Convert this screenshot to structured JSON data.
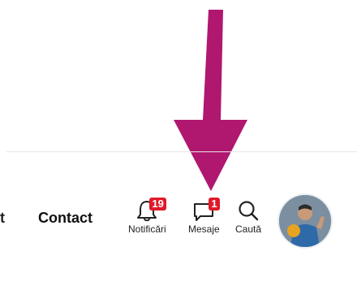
{
  "header": {
    "nav_partial": "t",
    "nav_contact": "Contact",
    "notifications": {
      "label": "Notificări",
      "badge": "19"
    },
    "messages": {
      "label": "Mesaje",
      "badge": "1"
    },
    "search": {
      "label": "Caută"
    }
  },
  "colors": {
    "arrow": "#b0176e",
    "badge": "#e0192a",
    "divider": "#e6e6e6"
  },
  "icons": [
    "bell-icon",
    "chat-icon",
    "search-icon",
    "avatar"
  ]
}
